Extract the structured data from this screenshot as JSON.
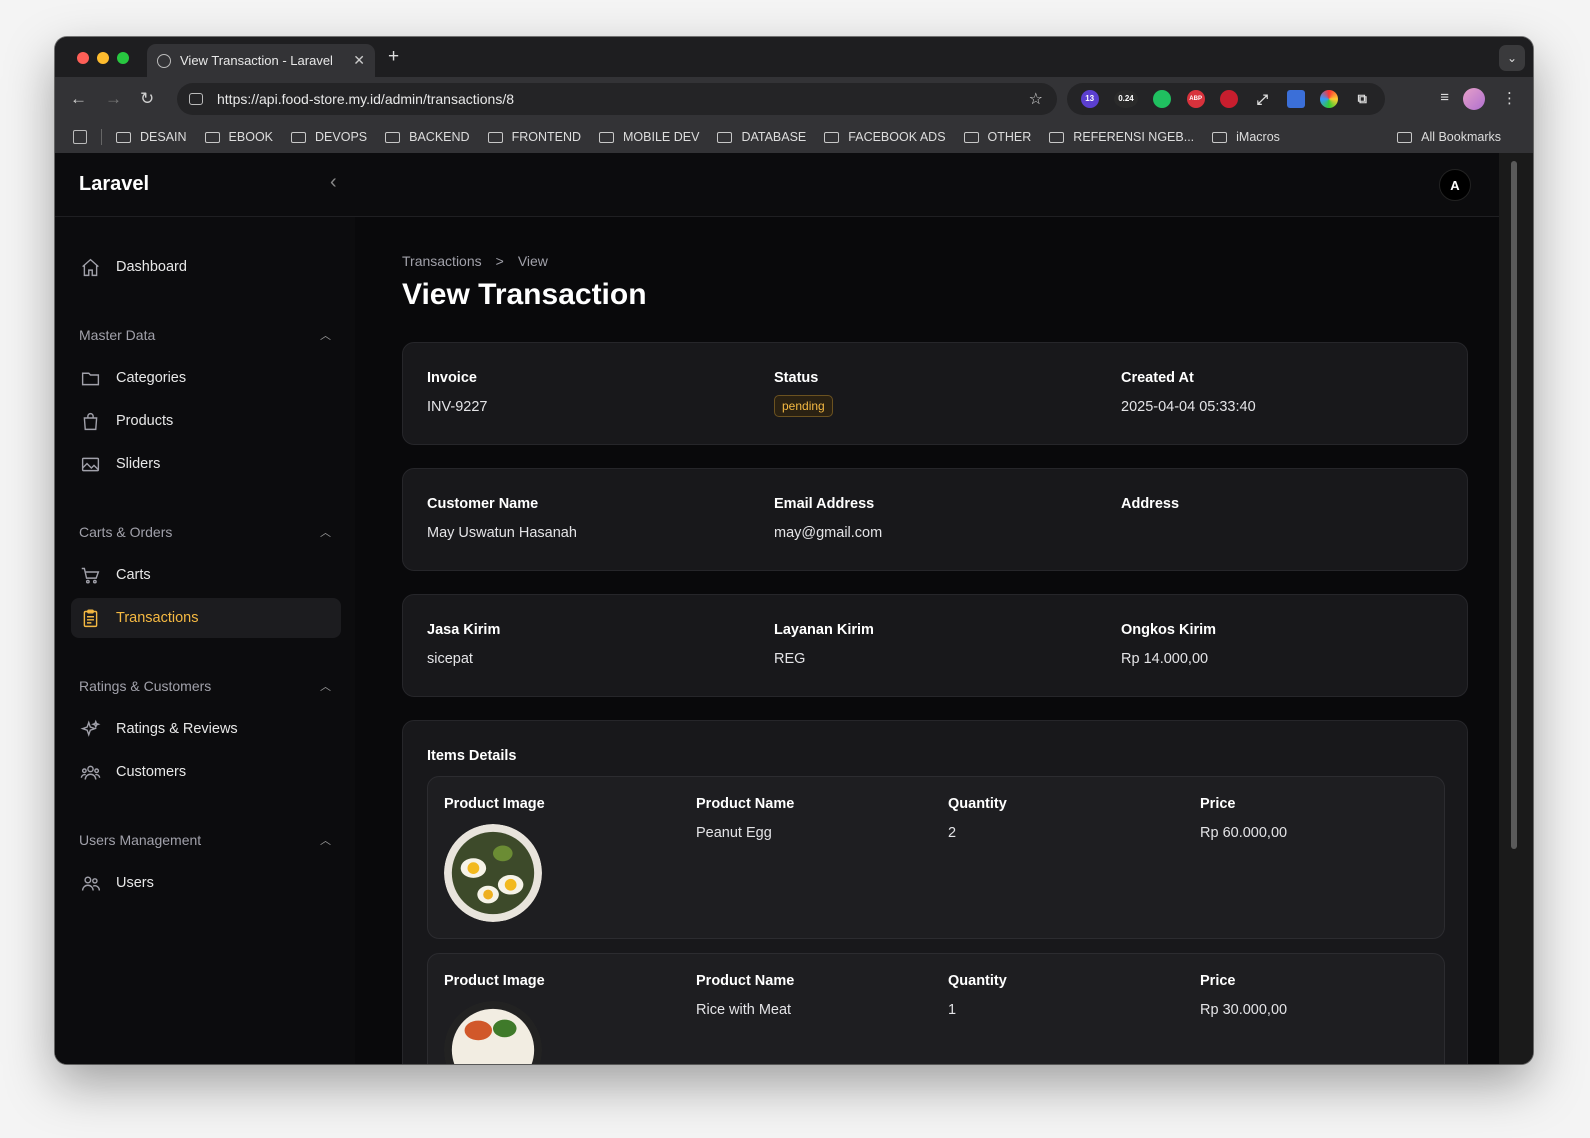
{
  "browser": {
    "tab_title": "View Transaction - Laravel",
    "tab_close": "✕",
    "new_tab": "+",
    "url": "https://api.food-store.my.id/admin/transactions/8",
    "ext_badges": {
      "count": "13",
      "score": "0.24",
      "abp": "ABP"
    },
    "bookmarks": [
      "DESAIN",
      "EBOOK",
      "DEVOPS",
      "BACKEND",
      "FRONTEND",
      "MOBILE DEV",
      "DATABASE",
      "FACEBOOK ADS",
      "OTHER",
      "REFERENSI NGEB...",
      "iMacros"
    ],
    "all_bookmarks": "All Bookmarks"
  },
  "app": {
    "brand": "Laravel",
    "avatar_initial": "A"
  },
  "sidebar": {
    "dashboard": "Dashboard",
    "groups": {
      "master_data": "Master Data",
      "carts_orders": "Carts & Orders",
      "ratings_customers": "Ratings & Customers",
      "users_management": "Users Management"
    },
    "items": {
      "categories": "Categories",
      "products": "Products",
      "sliders": "Sliders",
      "carts": "Carts",
      "transactions": "Transactions",
      "ratings_reviews": "Ratings & Reviews",
      "customers": "Customers",
      "users": "Users"
    }
  },
  "breadcrumb": {
    "parent": "Transactions",
    "separator": ">",
    "current": "View"
  },
  "page_title": "View Transaction",
  "invoice_card": {
    "invoice_label": "Invoice",
    "invoice_value": "INV-9227",
    "status_label": "Status",
    "status_value": "pending",
    "created_label": "Created At",
    "created_value": "2025-04-04 05:33:40"
  },
  "customer_card": {
    "name_label": "Customer Name",
    "name_value": "May Uswatun Hasanah",
    "email_label": "Email Address",
    "email_value": "may@gmail.com",
    "address_label": "Address",
    "address_value": ""
  },
  "shipping_card": {
    "courier_label": "Jasa Kirim",
    "courier_value": "sicepat",
    "service_label": "Layanan Kirim",
    "service_value": "REG",
    "cost_label": "Ongkos Kirim",
    "cost_value": "Rp 14.000,00"
  },
  "items": {
    "title": "Items Details",
    "headers": {
      "image": "Product Image",
      "name": "Product Name",
      "qty": "Quantity",
      "price": "Price"
    },
    "rows": [
      {
        "name": "Peanut Egg",
        "qty": "2",
        "price": "Rp 60.000,00"
      },
      {
        "name": "Rice with Meat",
        "qty": "1",
        "price": "Rp 30.000,00"
      }
    ]
  },
  "colors": {
    "accent": "#f5b942",
    "background": "#09090b",
    "card": "#18181b"
  }
}
